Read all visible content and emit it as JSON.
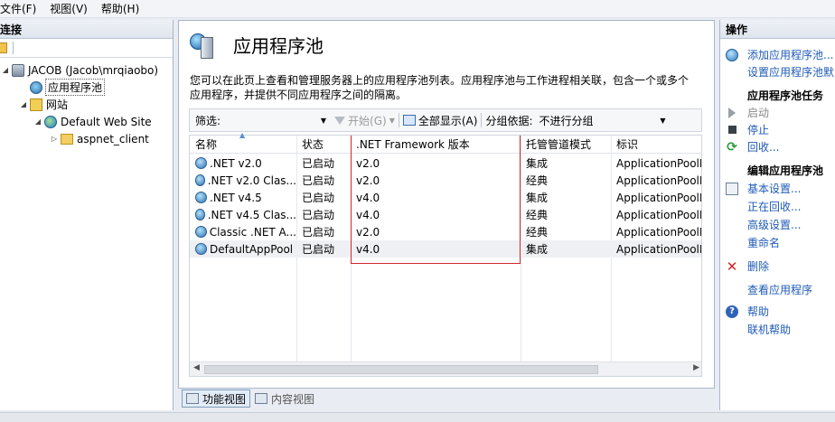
{
  "menu": {
    "file": "文件(F)",
    "view": "视图(V)",
    "help": "帮助(H)"
  },
  "left": {
    "header": "连接",
    "tree": {
      "server": "JACOB (Jacob\\mrqiaobo)",
      "app_pools": "应用程序池",
      "sites": "网站",
      "default_site": "Default Web Site",
      "aspnet_client": "aspnet_client"
    }
  },
  "main": {
    "title": "应用程序池",
    "description": "您可以在此页上查看和管理服务器上的应用程序池列表。应用程序池与工作进程相关联，包含一个或多个应用程序，并提供不同应用程序之间的隔离。",
    "filter": {
      "label": "筛选:",
      "value": "",
      "start_label": "开始(G)",
      "show_all_label": "全部显示(A)",
      "group_by_label": "分组依据:",
      "group_by_value": "不进行分组"
    },
    "columns": [
      "名称",
      "状态",
      ".NET Framework 版本",
      "托管管道模式",
      "标识"
    ],
    "rows": [
      {
        "name": ".NET v2.0",
        "status": "已启动",
        "version": "v2.0",
        "pipeline": "集成",
        "identity": "ApplicationPoolI"
      },
      {
        "name": ".NET v2.0 Clas...",
        "status": "已启动",
        "version": "v2.0",
        "pipeline": "经典",
        "identity": "ApplicationPoolI"
      },
      {
        "name": ".NET v4.5",
        "status": "已启动",
        "version": "v4.0",
        "pipeline": "集成",
        "identity": "ApplicationPoolI"
      },
      {
        "name": ".NET v4.5 Clas...",
        "status": "已启动",
        "version": "v4.0",
        "pipeline": "经典",
        "identity": "ApplicationPoolI"
      },
      {
        "name": "Classic .NET A...",
        "status": "已启动",
        "version": "v2.0",
        "pipeline": "经典",
        "identity": "ApplicationPoolI"
      },
      {
        "name": "DefaultAppPool",
        "status": "已启动",
        "version": "v4.0",
        "pipeline": "集成",
        "identity": "ApplicationPoolI"
      }
    ],
    "tabs": {
      "features": "功能视图",
      "content": "内容视图"
    }
  },
  "actions": {
    "header": "操作",
    "add_pool": "添加应用程序池...",
    "set_defaults": "设置应用程序池默",
    "pool_tasks_header": "应用程序池任务",
    "start": "启动",
    "stop": "停止",
    "recycle": "回收...",
    "edit_header": "编辑应用程序池",
    "basic_settings": "基本设置...",
    "recycling": "正在回收...",
    "advanced": "高级设置...",
    "rename": "重命名",
    "delete": "删除",
    "view_apps": "查看应用程序",
    "help": "帮助",
    "online_help": "联机帮助"
  },
  "colors": {
    "accent_link": "#1f5bb7",
    "highlight_box": "#d3262a"
  }
}
